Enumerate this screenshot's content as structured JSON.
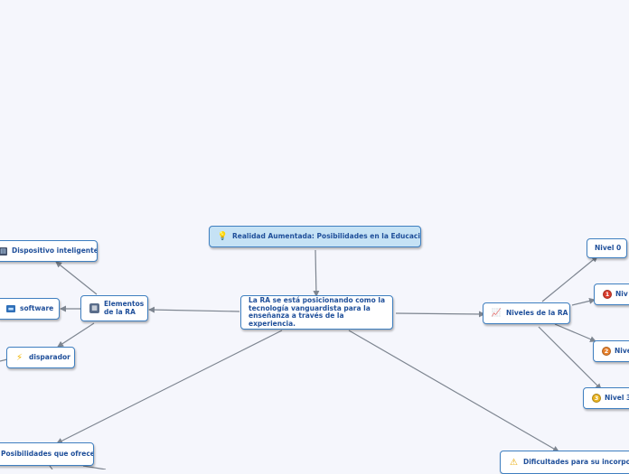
{
  "central": {
    "text": "La RA se está posicionando como la tecnología vanguardista para la enseñanza a través de la experiencia."
  },
  "root_topic": {
    "text": "Realidad Aumentada: Posibilidades en la Educación",
    "icon": "lightbulb-icon"
  },
  "elementos": {
    "label": "Elementos de la RA",
    "icon": "calculator-icon",
    "children": [
      {
        "label": "Dispositivo inteligente",
        "icon": "monitor-icon"
      },
      {
        "label": "software",
        "icon": "screen-icon"
      },
      {
        "label": "disparador",
        "icon": "lightning-icon"
      }
    ]
  },
  "niveles": {
    "label": "Niveles de la RA",
    "icon": "chart-icon",
    "children": [
      {
        "label": "Nivel 0",
        "badge": ""
      },
      {
        "label": "Niv",
        "badge": "1",
        "badge_color": "#d93b2b"
      },
      {
        "label": "Nive",
        "badge": "2",
        "badge_color": "#e7802a"
      },
      {
        "label": "Nivel 3",
        "badge": "3",
        "badge_color": "#e8b21e"
      }
    ]
  },
  "posibilidades": {
    "label": "Posibilidades que ofrece"
  },
  "dificultades": {
    "label": "Dificultades para su incorpora",
    "icon": "warning-icon"
  },
  "colors": {
    "connector": "#7d8590",
    "border": "#3f7fc0",
    "text": "#1f4f9a",
    "root_fill": "#c5e2f5",
    "background": "#f5f6fc"
  }
}
